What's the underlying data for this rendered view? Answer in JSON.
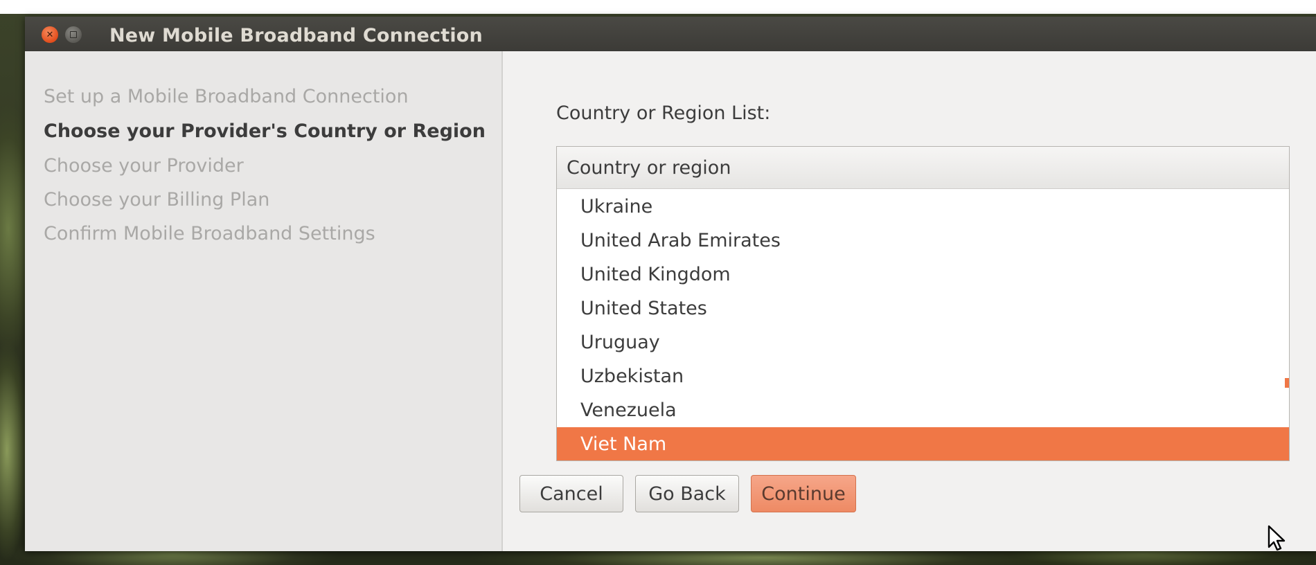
{
  "window": {
    "title": "New Mobile Broadband Connection"
  },
  "sidebar": {
    "steps": [
      {
        "label": "Set up a Mobile Broadband Connection",
        "active": false
      },
      {
        "label": "Choose your Provider's Country or Region",
        "active": true
      },
      {
        "label": "Choose your Provider",
        "active": false
      },
      {
        "label": "Choose your Billing Plan",
        "active": false
      },
      {
        "label": "Confirm Mobile Broadband Settings",
        "active": false
      }
    ]
  },
  "main": {
    "list_label": "Country or Region List:",
    "column_header": "Country or region",
    "countries": [
      "Ukraine",
      "United Arab Emirates",
      "United Kingdom",
      "United States",
      "Uruguay",
      "Uzbekistan",
      "Venezuela",
      "Viet Nam"
    ],
    "selected": "Viet Nam"
  },
  "buttons": {
    "cancel": "Cancel",
    "go_back": "Go Back",
    "continue": "Continue"
  },
  "colors": {
    "accent": "#f07746",
    "titlebar": "#3c3b37"
  }
}
